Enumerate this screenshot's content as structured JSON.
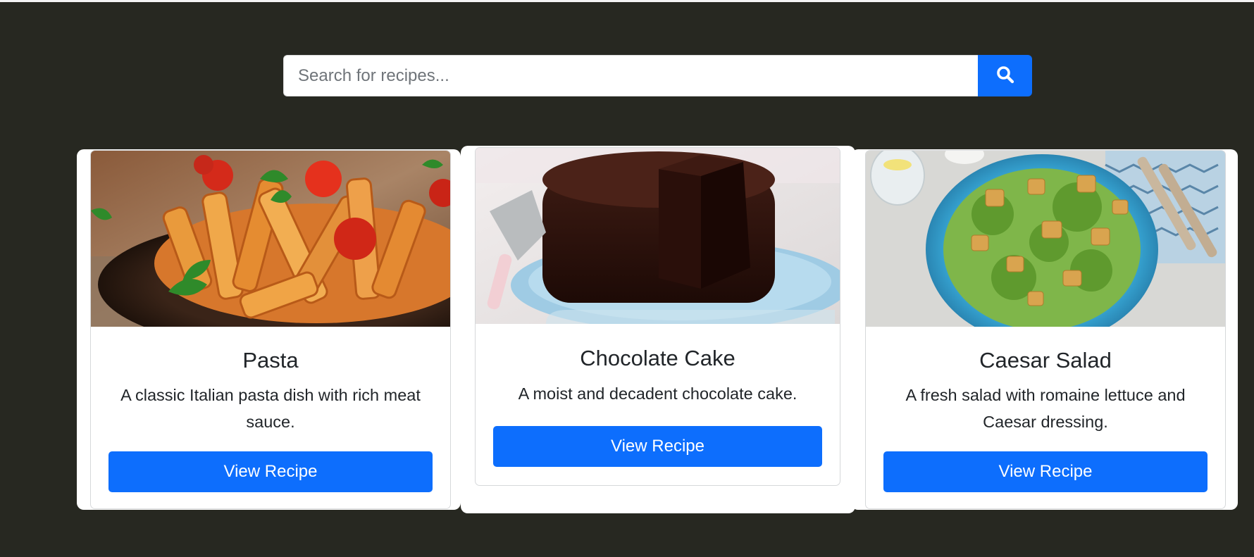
{
  "search": {
    "placeholder": "Search for recipes...",
    "button_icon": "search-icon"
  },
  "colors": {
    "background": "#272821",
    "accent": "#0d6efd"
  },
  "recipes": [
    {
      "title": "Pasta",
      "description": "A classic Italian pasta dish with rich meat sauce.",
      "button_label": "View Recipe",
      "image": "pasta-photo"
    },
    {
      "title": "Chocolate Cake",
      "description": "A moist and decadent chocolate cake.",
      "button_label": "View Recipe",
      "image": "chocolate-cake-photo"
    },
    {
      "title": "Caesar Salad",
      "description": "A fresh salad with romaine lettuce and Caesar dressing.",
      "button_label": "View Recipe",
      "image": "caesar-salad-photo"
    }
  ]
}
